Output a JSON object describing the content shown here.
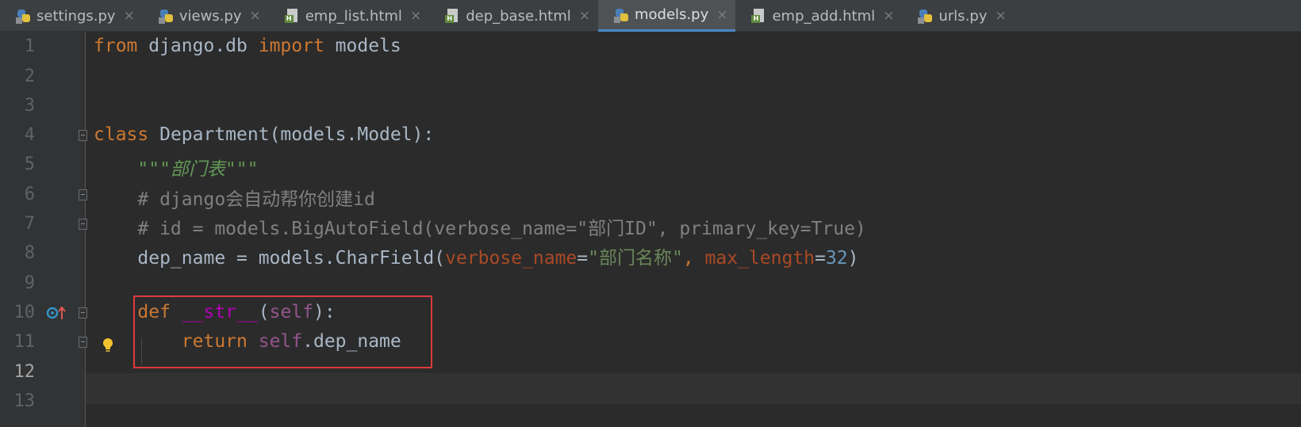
{
  "tabs": [
    {
      "label": "settings.py",
      "type": "py"
    },
    {
      "label": "views.py",
      "type": "py"
    },
    {
      "label": "emp_list.html",
      "type": "html"
    },
    {
      "label": "dep_base.html",
      "type": "html"
    },
    {
      "label": "models.py",
      "type": "py",
      "active": true
    },
    {
      "label": "emp_add.html",
      "type": "html"
    },
    {
      "label": "urls.py",
      "type": "py"
    }
  ],
  "close_glyph": "×",
  "line_numbers": [
    "1",
    "2",
    "3",
    "4",
    "5",
    "6",
    "7",
    "8",
    "9",
    "10",
    "11",
    "12",
    "13"
  ],
  "code": {
    "l1": {
      "t1": "from",
      "t2": " django.db ",
      "t3": "import",
      "t4": " models"
    },
    "l4": {
      "t1": "class",
      "t2": " Department(models.Model):"
    },
    "l5": {
      "t1": "    \"\"\"部门表\"\"\""
    },
    "l6": {
      "t1": "    # django会自动帮你创建id"
    },
    "l7": {
      "t1": "    # id = models.BigAutoField(verbose_name=\"部门ID\", primary_key=True)"
    },
    "l8": {
      "t1": "    dep_name = models.CharField(",
      "t2": "verbose_name",
      "t3": "=",
      "t4": "\"部门名称\"",
      "t5": ", ",
      "t6": "max_length",
      "t7": "=",
      "t8": "32",
      "t9": ")"
    },
    "l10": {
      "t1": "    ",
      "t2": "def",
      "t3": " ",
      "t4": "__str__",
      "t5": "(",
      "t6": "self",
      "t7": "):"
    },
    "l11": {
      "t1": "        ",
      "t2": "return",
      "t3": " ",
      "t4": "self",
      "t5": ".dep_name"
    }
  },
  "colors": {
    "accent": "#4a88c7",
    "highlight_box": "#e0393e",
    "background": "#2b2b2b",
    "keyword": "#cc7832",
    "string": "#6a8759",
    "comment": "#808080"
  },
  "icons": {
    "python_file": "python-file-icon",
    "html_file": "html-file-icon",
    "override": "override-method-icon",
    "intention": "lightbulb-icon"
  }
}
